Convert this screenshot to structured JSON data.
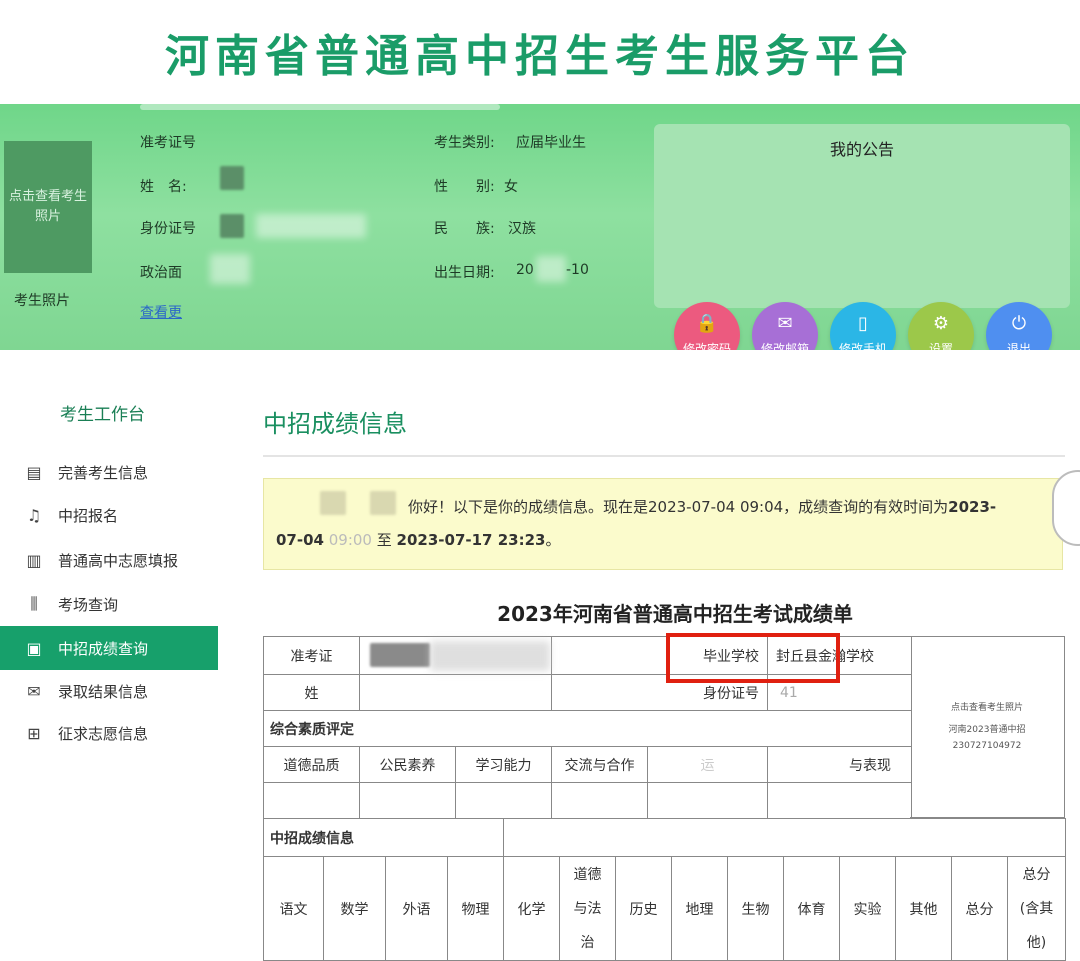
{
  "site": {
    "title": "河南省普通高中招生考生服务平台"
  },
  "profile": {
    "photo_prompt": "点击查看考生照片",
    "photo_caption": "考生照片",
    "labels": {
      "exam_no": "准考证号",
      "name": "姓　名:",
      "id_no": "身份证号",
      "political": "政治面",
      "category": "考生类别:",
      "gender": "性　　别:",
      "ethnicity": "民　　族:",
      "birth": "出生日期:"
    },
    "values": {
      "category": "应届毕业生",
      "gender": "女",
      "ethnicity": "汉族",
      "birth_start": "20",
      "birth_end": "-10"
    },
    "more_link": "查看更"
  },
  "notice": {
    "title": "我的公告"
  },
  "actions": [
    {
      "label": "修改密码",
      "icon": "lock-icon",
      "glyph": "🔒",
      "color": "#ec5a7f"
    },
    {
      "label": "修改邮箱",
      "icon": "mail-icon",
      "glyph": "✉",
      "color": "#a76fd6"
    },
    {
      "label": "修改手机",
      "icon": "phone-icon",
      "glyph": "▯",
      "color": "#2bb6e6"
    },
    {
      "label": "设置",
      "icon": "gear-icon",
      "glyph": "⚙",
      "color": "#9cc84a"
    },
    {
      "label": "退出",
      "icon": "power-icon",
      "glyph": "⏻",
      "color": "#4f8ff0"
    }
  ],
  "sidebar": {
    "title": "考生工作台",
    "items": [
      {
        "label": "完善考生信息",
        "icon": "id-card-icon",
        "glyph": "▤"
      },
      {
        "label": "中招报名",
        "icon": "bell-icon",
        "glyph": "♫"
      },
      {
        "label": "普通高中志愿填报",
        "icon": "building-icon",
        "glyph": "▥"
      },
      {
        "label": "考场查询",
        "icon": "sliders-icon",
        "glyph": "⫼"
      },
      {
        "label": "中招成绩查询",
        "icon": "score-doc-icon",
        "glyph": "▣"
      },
      {
        "label": "录取结果信息",
        "icon": "envelope-icon",
        "glyph": "✉"
      },
      {
        "label": "征求志愿信息",
        "icon": "form-add-icon",
        "glyph": "⊞"
      }
    ],
    "active_index": 4
  },
  "main": {
    "title": "中招成绩信息",
    "message": {
      "greeting": "你好！以下是你的成绩信息。现在是2023-07-04 09:04，成绩查询的有效时间为",
      "start_bold_1": "2023-",
      "start_bold_2": "07-04",
      "start_time": " 09:00",
      "connector": " 至 ",
      "end_bold": "2023-07-17 23:23",
      "end_tail": "。"
    }
  },
  "report": {
    "title": "2023年河南省普通高中招生考试成绩单",
    "labels": {
      "exam_no": "准考证",
      "school": "毕业学校",
      "name": "姓",
      "id_no": "身份证号",
      "quality": "综合素质评定",
      "scores": "中招成绩信息"
    },
    "school_value": "封丘县金瀚学校",
    "id_prefix": "41",
    "photo_cell": {
      "line1": "点击查看考生照片",
      "line2": "河南2023普通中招",
      "line3": "230727104972"
    },
    "quality_columns": [
      "道德品质",
      "公民素养",
      "学习能力",
      "交流与合作",
      "运",
      "与表现"
    ],
    "score_columns": [
      {
        "label": "语文"
      },
      {
        "label": "数学"
      },
      {
        "label": "外语"
      },
      {
        "label": "物理"
      },
      {
        "label": "化学"
      },
      {
        "label_lines": [
          "道德",
          "与法",
          "治"
        ]
      },
      {
        "label": "历史"
      },
      {
        "label": "地理"
      },
      {
        "label": "生物"
      },
      {
        "label": "体育"
      },
      {
        "label": "实验"
      },
      {
        "label": "其他"
      },
      {
        "label": "总分"
      },
      {
        "label_lines": [
          "总分",
          "(含其",
          "他)"
        ]
      }
    ]
  }
}
